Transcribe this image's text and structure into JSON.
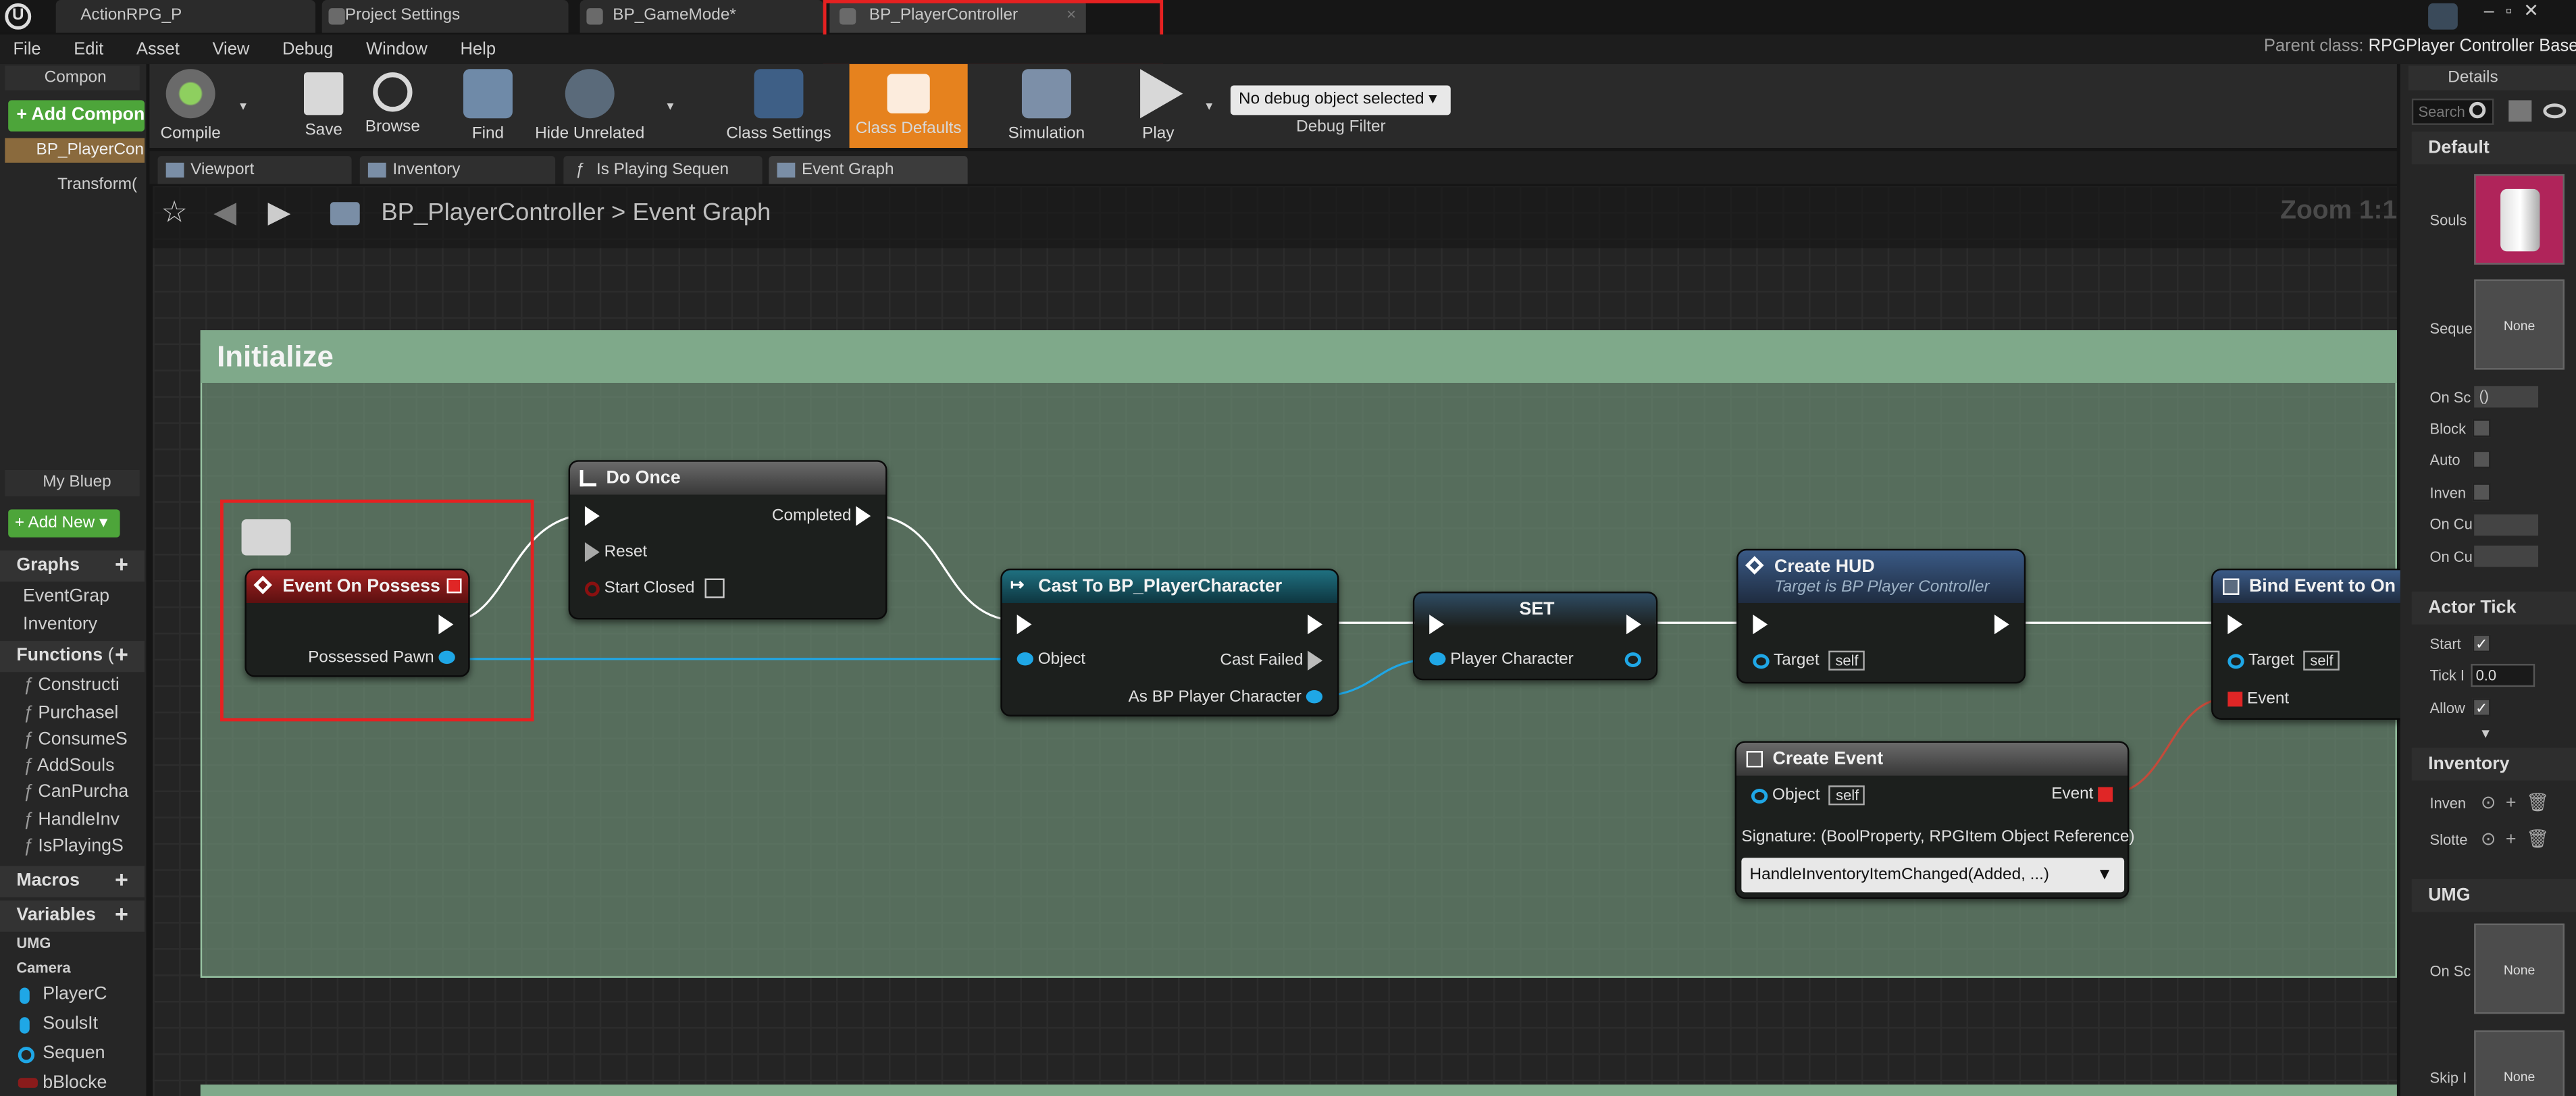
{
  "app": {
    "parent_class_label": "Parent class:",
    "parent_class_value": "RPGPlayer Controller Base"
  },
  "tabs": [
    {
      "label": "ActionRPG_P"
    },
    {
      "label": "Project Settings"
    },
    {
      "label": "BP_GameMode*"
    },
    {
      "label": "BP_PlayerController"
    }
  ],
  "menu": [
    "File",
    "Edit",
    "Asset",
    "View",
    "Debug",
    "Window",
    "Help"
  ],
  "toolbar": {
    "compile": "Compile",
    "save": "Save",
    "browse": "Browse",
    "find": "Find",
    "hide_unrelated": "Hide Unrelated",
    "class_settings": "Class Settings",
    "class_defaults": "Class Defaults",
    "simulation": "Simulation",
    "play": "Play",
    "debug_object": "No debug object selected",
    "debug_filter": "Debug Filter"
  },
  "components": {
    "title": "Compon",
    "add": "+ Add Compon",
    "root": "BP_PlayerCon",
    "child": "Transform("
  },
  "graph_tabs": [
    "Viewport",
    "Inventory",
    "Is Playing Sequen",
    "Event Graph"
  ],
  "breadcrumb": {
    "bp": "BP_PlayerController",
    "sep": ">",
    "graph": "Event Graph",
    "zoom": "Zoom 1:1"
  },
  "myblueprint": {
    "title": "My Bluep",
    "add_new": "+ Add New",
    "graphs_header": "Graphs",
    "graphs": [
      "EventGrap",
      "Inventory"
    ],
    "functions_header": "Functions",
    "functions_count": "(",
    "functions": [
      "Constructi",
      "Purchasel",
      "ConsumeS",
      "AddSouls",
      "CanPurcha",
      "HandleInv",
      "IsPlayingS"
    ],
    "macros_header": "Macros",
    "variables_header": "Variables",
    "var_cats": [
      "UMG",
      "Camera"
    ],
    "variables": [
      "PlayerC",
      "SoulsIt",
      "Sequen",
      "bBlocke"
    ]
  },
  "comment": {
    "title": "Initialize"
  },
  "nodes": {
    "event": {
      "title": "Event On Possess",
      "pin": "Possessed Pawn"
    },
    "doonce": {
      "title": "Do Once",
      "completed": "Completed",
      "reset": "Reset",
      "start_closed": "Start Closed"
    },
    "cast": {
      "title": "Cast To BP_PlayerCharacter",
      "object": "Object",
      "cast_failed": "Cast Failed",
      "as": "As BP Player Character"
    },
    "set": {
      "title": "SET",
      "pin": "Player Character"
    },
    "hud": {
      "title": "Create HUD",
      "subtitle": "Target is BP Player Controller",
      "target": "Target",
      "self": "self"
    },
    "createevent": {
      "title": "Create Event",
      "object": "Object",
      "self": "self",
      "event": "Event",
      "signature": "Signature: (BoolProperty, RPGItem Object Reference)",
      "dropdown": "HandleInventoryItemChanged(Added, ...)"
    },
    "bind": {
      "title": "Bind Event to On I",
      "target": "Target",
      "self": "self",
      "event": "Event"
    }
  },
  "details": {
    "title": "Details",
    "search": "Search",
    "default": "Default",
    "souls": "Souls",
    "seq": "Seque",
    "none1": "None",
    "on_sc": "On Sc",
    "on_sc_val": "()",
    "block": "Block",
    "auto": "Auto",
    "inven": "Inven",
    "on_cu1": "On Cu",
    "on_cu2": "On Cu",
    "actor_tick": "Actor Tick",
    "start": "Start",
    "tick": "Tick I",
    "tick_val": "0.0",
    "allow": "Allow",
    "inventory": "Inventory",
    "inv1": "Inven",
    "inv2": "Slotte",
    "umg": "UMG",
    "umg_on": "On Sc",
    "none2": "None",
    "skip": "Skip I",
    "none3": "None"
  },
  "colors": {
    "accent": "#e6821e",
    "highlight_box": "#e52121",
    "comment_bg": "#7fa98a",
    "event_head": "#8b1b1b",
    "cast_head": "#1b5b6a",
    "func_head": "#2a4a73"
  }
}
